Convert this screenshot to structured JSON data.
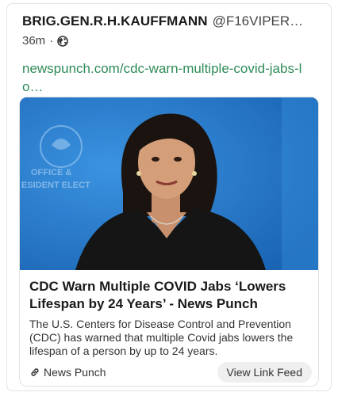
{
  "post": {
    "author_name": "BRIG.GEN.R.H.KAUFFMANN",
    "author_handle": "@F16VIPER…",
    "time_ago": "36m",
    "visibility_icon": "globe-icon",
    "link_text": "newspunch.com/cdc-warn-multiple-covid-jabs-lo…"
  },
  "card": {
    "image_icon": "news-photo",
    "image_overlay_text": "OFFICE OF THE PRESIDENT ELECT",
    "title": "CDC Warn Multiple COVID Jabs ‘Lowers Lifespan by 24 Years’ - News Punch",
    "description": "The U.S. Centers for Disease Control and Prevention (CDC) has warned that multiple Covid jabs lowers the lifespan of a person by up to 24 years.",
    "source_icon": "link-icon",
    "source_name": "News Punch",
    "view_button_label": "View Link Feed"
  },
  "colors": {
    "link": "#2e8b57",
    "image_background": "#1f78cc",
    "button_background": "#efefef"
  }
}
